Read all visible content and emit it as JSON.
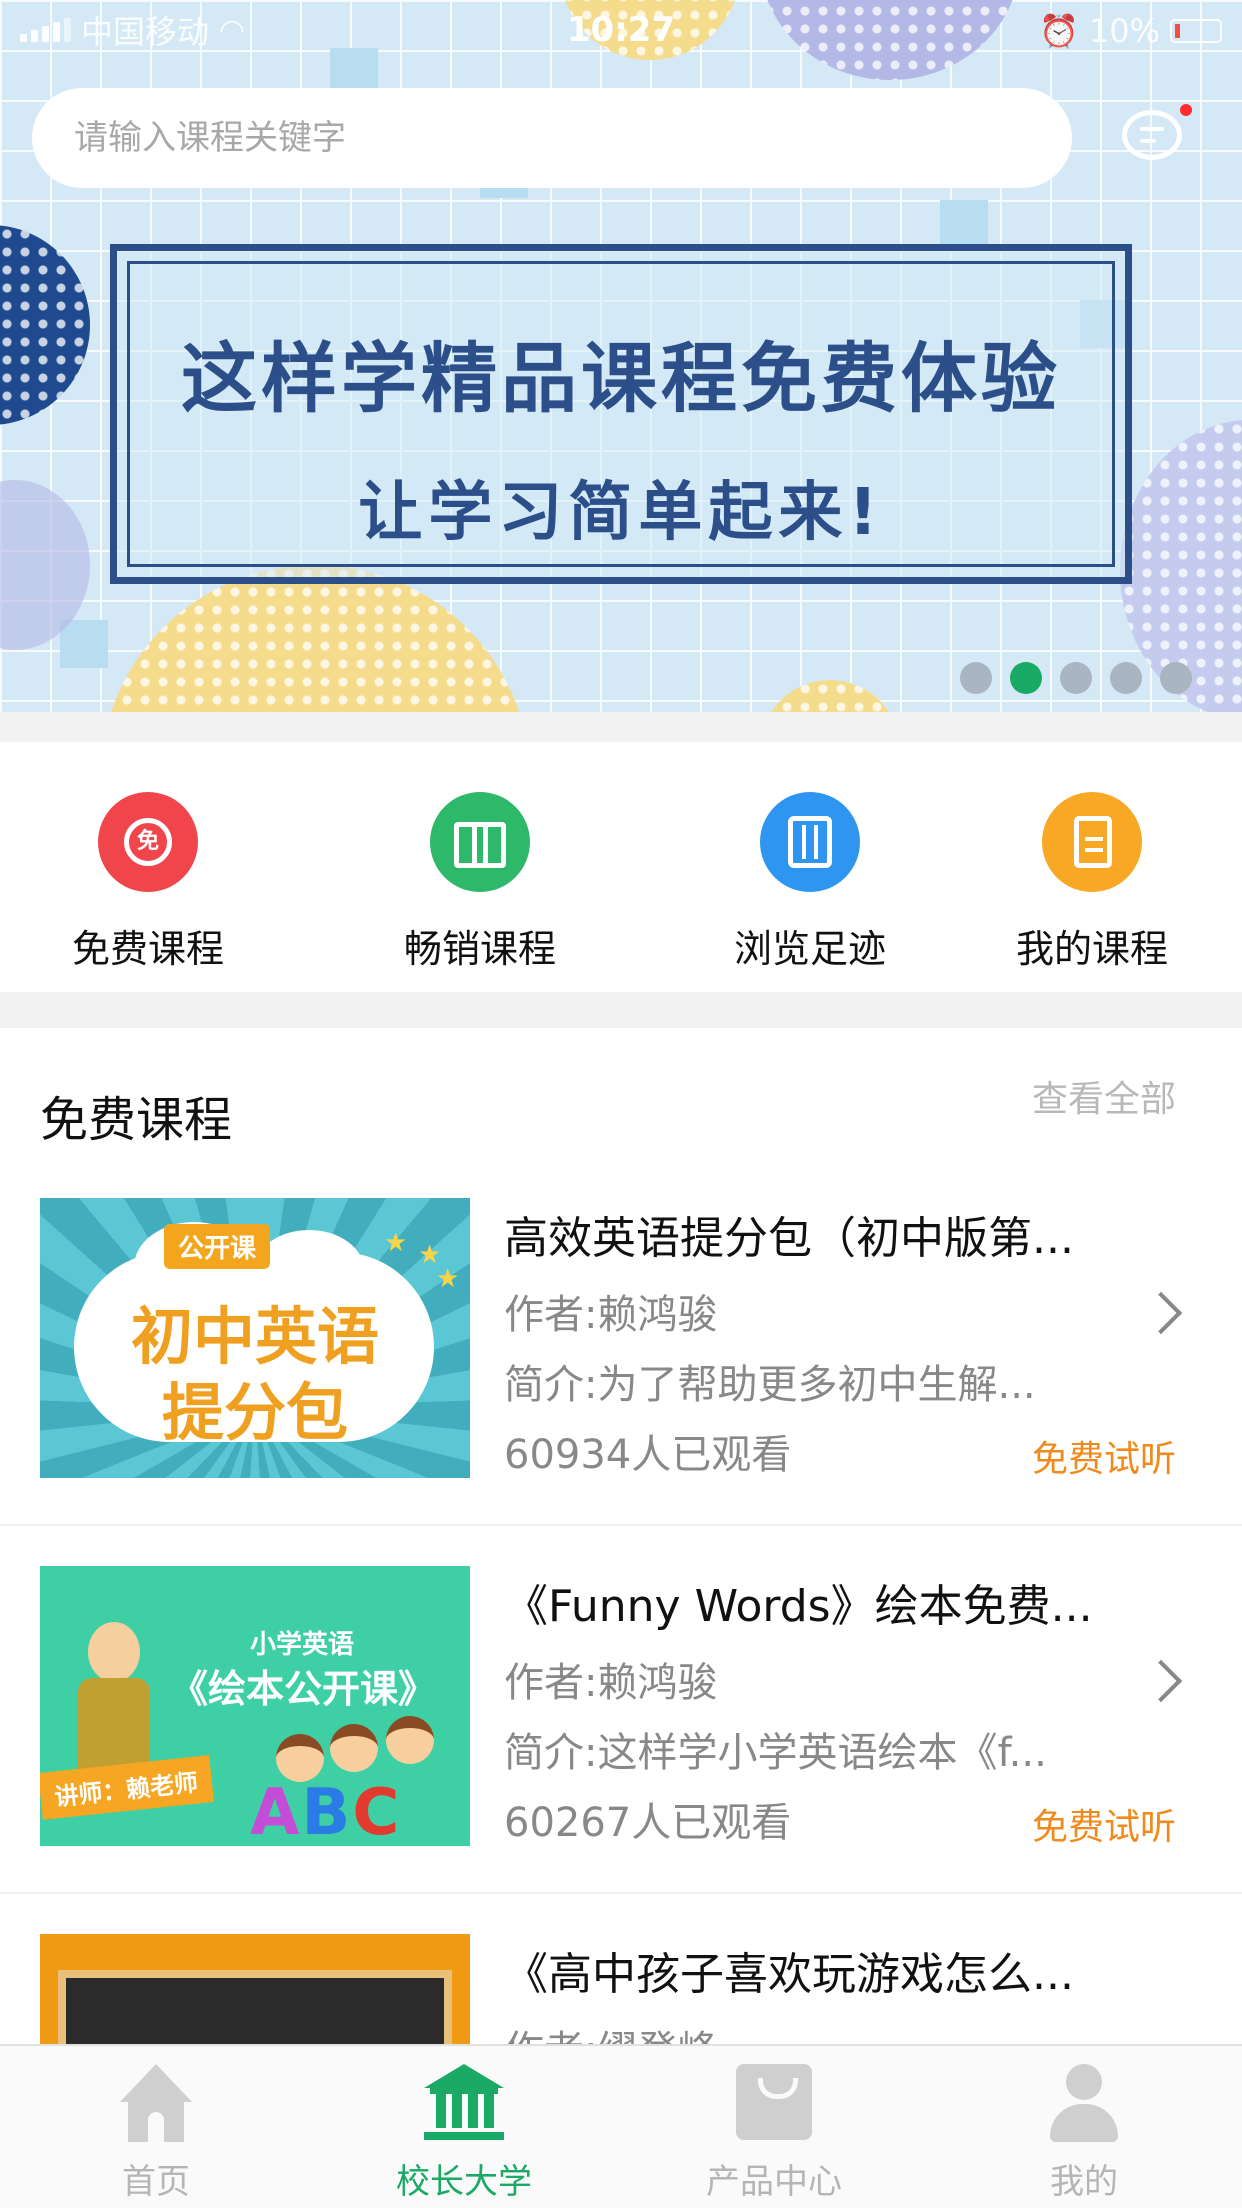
{
  "status_bar": {
    "carrier": "中国移动",
    "time": "10:27",
    "battery": "10%"
  },
  "search": {
    "placeholder": "请输入课程关键字"
  },
  "banner": {
    "line1": "这样学精品课程免费体验",
    "line2": "让学习简单起来!",
    "page_count": 5,
    "active_page": 2
  },
  "quick_entries": [
    {
      "label": "免费课程",
      "icon": "free-icon",
      "color": "#f0454a"
    },
    {
      "label": "畅销课程",
      "icon": "book-icon",
      "color": "#2eb86a"
    },
    {
      "label": "浏览足迹",
      "icon": "history-icon",
      "color": "#2e95f0"
    },
    {
      "label": "我的课程",
      "icon": "document-icon",
      "color": "#f8a825"
    }
  ],
  "free_section": {
    "title": "免费课程",
    "view_all": "查看全部",
    "courses": [
      {
        "title": "高效英语提分包（初中版第...",
        "author": "作者:赖鸿骏",
        "intro": "简介:为了帮助更多初中生解...",
        "views": "60934人已观看",
        "trial": "免费试听",
        "thumb": {
          "badge": "公开课",
          "line1": "初中英语",
          "line2": "提分包"
        }
      },
      {
        "title": "《Funny Words》绘本免费...",
        "author": "作者:赖鸿骏",
        "intro": "简介:这样学小学英语绘本《f...",
        "views": "60267人已观看",
        "trial": "免费试听",
        "thumb": {
          "small": "小学英语",
          "main": "《绘本公开课》",
          "teacher": "讲师：赖老师",
          "abc": [
            "A",
            "B",
            "C"
          ]
        }
      },
      {
        "title": "《高中孩子喜欢玩游戏怎么...",
        "author": "作者:缪登峰"
      }
    ]
  },
  "tabbar": [
    {
      "label": "首页",
      "icon": "home-icon",
      "active": false
    },
    {
      "label": "校长大学",
      "icon": "university-icon",
      "active": true
    },
    {
      "label": "产品中心",
      "icon": "shopping-bag-icon",
      "active": false
    },
    {
      "label": "我的",
      "icon": "user-icon",
      "active": false
    }
  ],
  "colors": {
    "accent": "#1ba966",
    "trial": "#f08a1c",
    "banner_text": "#2c4f8a"
  }
}
